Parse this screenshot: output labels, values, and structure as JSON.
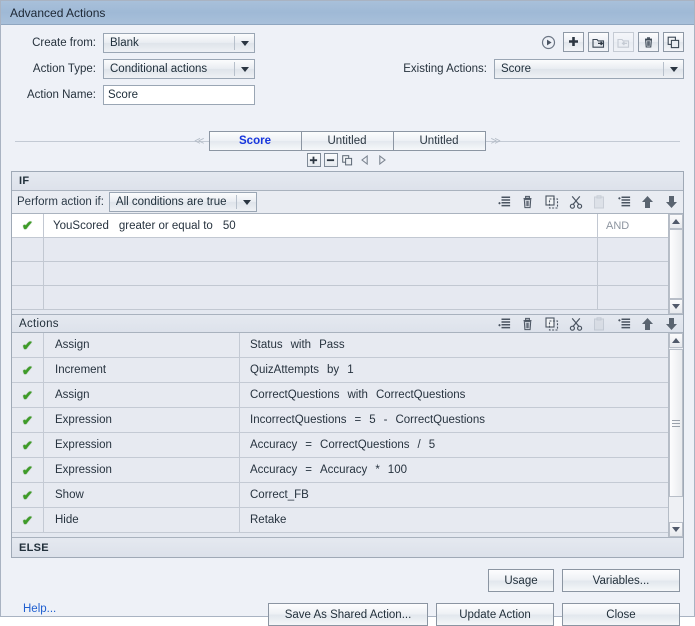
{
  "window": {
    "title": "Advanced Actions"
  },
  "header": {
    "create_from": {
      "label": "Create from:",
      "value": "Blank"
    },
    "action_type": {
      "label": "Action Type:",
      "value": "Conditional actions"
    },
    "action_name": {
      "label": "Action Name:",
      "value": "Score"
    },
    "existing_actions": {
      "label": "Existing Actions:",
      "value": "Score"
    },
    "toolbar": [
      {
        "name": "preview-action-button",
        "glyph": "▶",
        "disabled": false,
        "flat": true
      },
      {
        "name": "add-action-button",
        "glyph": "✛",
        "disabled": false,
        "flat": false
      },
      {
        "name": "export-action-button",
        "glyph": "⇥",
        "disabled": false,
        "flat": false
      },
      {
        "name": "import-action-button",
        "glyph": "⇤",
        "disabled": true,
        "flat": false
      },
      {
        "name": "delete-action-button",
        "glyph": "🗑",
        "disabled": false,
        "flat": false
      },
      {
        "name": "duplicate-action-button",
        "glyph": "❐",
        "disabled": false,
        "flat": false
      }
    ]
  },
  "tabs": {
    "items": [
      {
        "label": "Score",
        "active": true
      },
      {
        "label": "Untitled",
        "active": false
      },
      {
        "label": "Untitled",
        "active": false
      }
    ],
    "tools": [
      {
        "name": "add-tab-button",
        "glyph": "✚",
        "boxed": true
      },
      {
        "name": "remove-tab-button",
        "glyph": "━",
        "boxed": true
      },
      {
        "name": "copy-tab-button",
        "glyph": "❐",
        "boxed": false
      },
      {
        "name": "previous-tab-button",
        "glyph": "◁",
        "boxed": false
      },
      {
        "name": "next-tab-button",
        "glyph": "▷",
        "boxed": false
      }
    ]
  },
  "if_section": {
    "title": "IF",
    "perform_label": "Perform action if:",
    "perform_value": "All conditions are true",
    "row_tools": [
      {
        "name": "add-condition-row-icon",
        "glyph": "≣",
        "disabled": false
      },
      {
        "name": "delete-condition-row-icon",
        "glyph": "🗑",
        "disabled": false
      },
      {
        "name": "copy-condition-row-icon",
        "glyph": "⧉",
        "disabled": false
      },
      {
        "name": "cut-condition-row-icon",
        "glyph": "✂",
        "disabled": false
      },
      {
        "name": "paste-condition-row-icon",
        "glyph": "📋",
        "disabled": true
      },
      {
        "name": "insert-condition-row-icon",
        "glyph": "≣",
        "disabled": false
      },
      {
        "name": "move-condition-up-icon",
        "glyph": "⬆",
        "disabled": false
      },
      {
        "name": "move-condition-down-icon",
        "glyph": "⬇",
        "disabled": false
      }
    ],
    "conditions": [
      {
        "enabled": true,
        "variable": "YouScored",
        "operator": "greater or equal to",
        "value": "50",
        "conjunction": "AND",
        "active": true
      },
      {
        "enabled": false,
        "variable": "",
        "operator": "",
        "value": "",
        "conjunction": "",
        "active": false
      },
      {
        "enabled": false,
        "variable": "",
        "operator": "",
        "value": "",
        "conjunction": "",
        "active": false
      },
      {
        "enabled": false,
        "variable": "",
        "operator": "",
        "value": "",
        "conjunction": "",
        "active": false
      }
    ]
  },
  "actions_section": {
    "title": "Actions",
    "row_tools": [
      {
        "name": "add-action-row-icon",
        "glyph": "≣",
        "disabled": false
      },
      {
        "name": "delete-action-row-icon",
        "glyph": "🗑",
        "disabled": false
      },
      {
        "name": "copy-action-row-icon",
        "glyph": "⧉",
        "disabled": false
      },
      {
        "name": "cut-action-row-icon",
        "glyph": "✂",
        "disabled": false
      },
      {
        "name": "paste-action-row-icon",
        "glyph": "📋",
        "disabled": true
      },
      {
        "name": "insert-action-row-icon",
        "glyph": "≣",
        "disabled": false
      },
      {
        "name": "move-action-up-icon",
        "glyph": "⬆",
        "disabled": false
      },
      {
        "name": "move-action-down-icon",
        "glyph": "⬇",
        "disabled": false
      }
    ],
    "rows": [
      {
        "enabled": true,
        "type": "Assign",
        "expression": [
          "Status",
          "with",
          "Pass"
        ]
      },
      {
        "enabled": true,
        "type": "Increment",
        "expression": [
          "QuizAttempts",
          "by",
          "1"
        ]
      },
      {
        "enabled": true,
        "type": "Assign",
        "expression": [
          "CorrectQuestions",
          "with",
          "CorrectQuestions"
        ]
      },
      {
        "enabled": true,
        "type": "Expression",
        "expression": [
          "IncorrectQuestions",
          "=",
          "5",
          "-",
          "CorrectQuestions"
        ]
      },
      {
        "enabled": true,
        "type": "Expression",
        "expression": [
          "Accuracy",
          "=",
          "CorrectQuestions",
          "/",
          "5"
        ]
      },
      {
        "enabled": true,
        "type": "Expression",
        "expression": [
          "Accuracy",
          "=",
          "Accuracy",
          "*",
          "100"
        ]
      },
      {
        "enabled": true,
        "type": "Show",
        "expression": [
          "Correct_FB"
        ]
      },
      {
        "enabled": true,
        "type": "Hide",
        "expression": [
          "Retake"
        ]
      }
    ]
  },
  "else_section": {
    "title": "ELSE"
  },
  "footer": {
    "usage": "Usage",
    "variables": "Variables...",
    "save_as_shared": "Save As Shared Action...",
    "update_action": "Update Action",
    "close": "Close",
    "help": "Help..."
  },
  "colors": {
    "titlebar": "#a8c0da",
    "accent_tab_active": "#1735dd",
    "check_green": "#3e9c28",
    "link_blue": "#1f5fd0",
    "panel_bg": "#e8ebf2"
  }
}
